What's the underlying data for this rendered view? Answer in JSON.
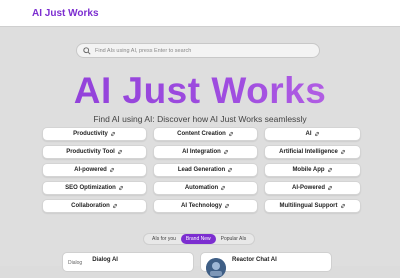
{
  "header": {
    "brand": "AI Just Works"
  },
  "search": {
    "placeholder": "Find AIs using AI, press Enter to search"
  },
  "hero": {
    "title": "AI Just Works",
    "subtitle": "Find AI using AI: Discover how AI Just Works seamlessly"
  },
  "tags": [
    {
      "label": "Productivity"
    },
    {
      "label": "Content Creation"
    },
    {
      "label": "AI"
    },
    {
      "label": "Productivity Tool"
    },
    {
      "label": "AI Integration"
    },
    {
      "label": "Artificial Intelligence"
    },
    {
      "label": "AI-powered"
    },
    {
      "label": "Lead Generation"
    },
    {
      "label": "Mobile App"
    },
    {
      "label": "SEO Optimization"
    },
    {
      "label": "Automation"
    },
    {
      "label": "AI-Powered"
    },
    {
      "label": "Collaboration"
    },
    {
      "label": "AI Technology"
    },
    {
      "label": "Multilingual Support"
    }
  ],
  "tabs": [
    {
      "label": "AIs for you",
      "active": false
    },
    {
      "label": "Brand New",
      "active": true
    },
    {
      "label": "Popular AIs",
      "active": false
    }
  ],
  "cards": [
    {
      "logo_text": "Dialog",
      "title": "Dialog AI"
    },
    {
      "title": "Reactor Chat AI"
    }
  ],
  "colors": {
    "accent": "#7c2ed0",
    "background": "#dedede"
  }
}
